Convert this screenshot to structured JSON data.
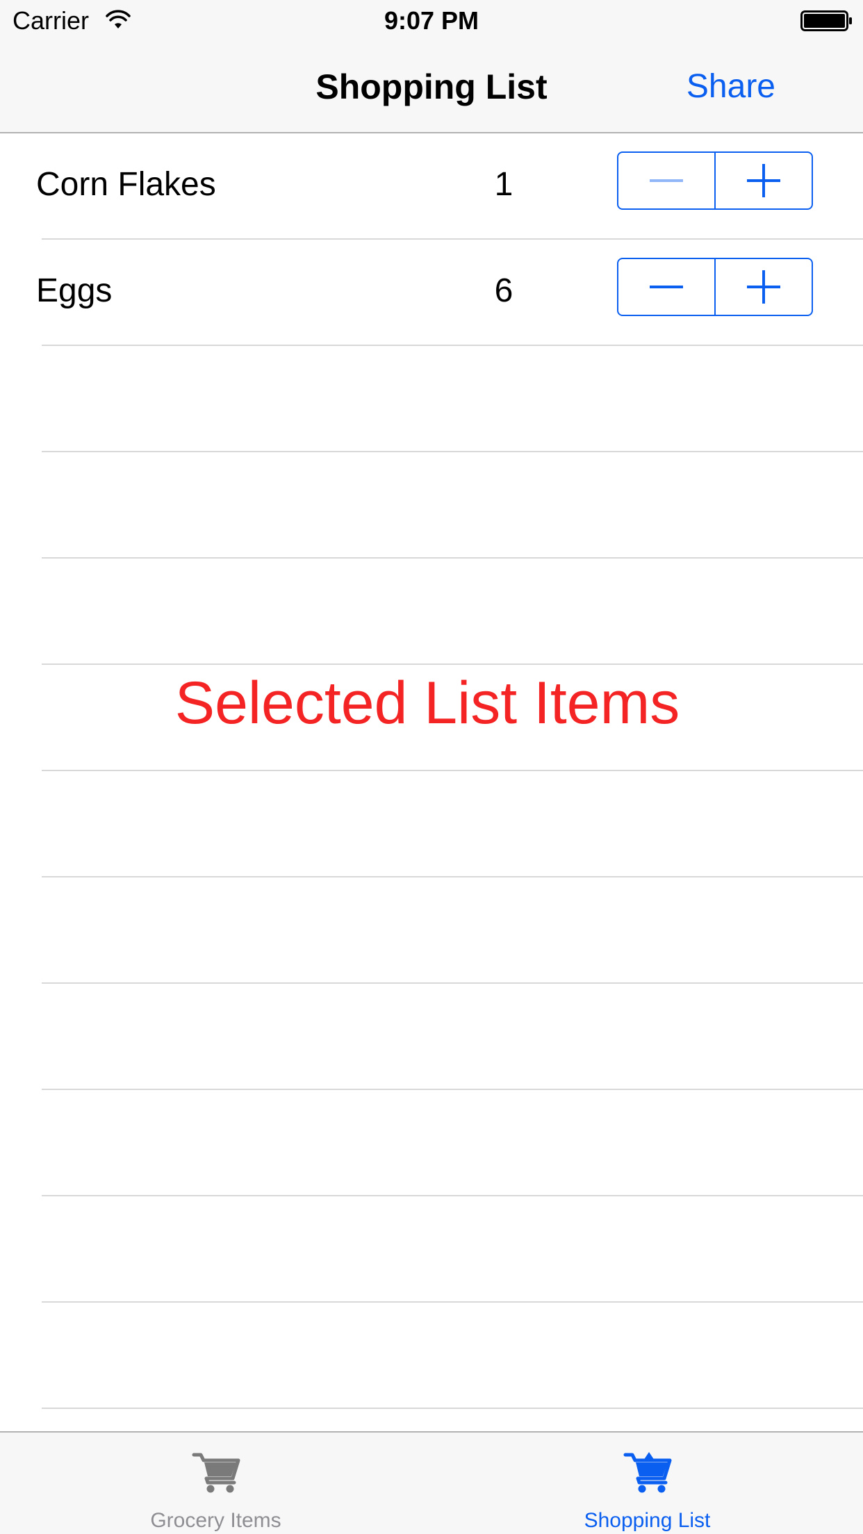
{
  "status_bar": {
    "carrier": "Carrier",
    "time": "9:07 PM",
    "wifi_icon": "wifi-icon",
    "battery_icon": "battery-full-icon"
  },
  "nav_bar": {
    "title": "Shopping List",
    "share_label": "Share"
  },
  "items": [
    {
      "name": "Corn Flakes",
      "quantity": "1",
      "minus_enabled": false
    },
    {
      "name": "Eggs",
      "quantity": "6",
      "minus_enabled": true
    }
  ],
  "overlay_caption": "Selected List Items",
  "tab_bar": {
    "tabs": [
      {
        "label": "Grocery Items",
        "icon": "cart-icon",
        "selected": false
      },
      {
        "label": "Shopping List",
        "icon": "cart-filled-icon",
        "selected": true
      }
    ]
  },
  "colors": {
    "accent": "#0a5ff0",
    "caption": "#f42424",
    "inactive_tab": "#8e8e93",
    "bar_background": "#f7f7f7"
  }
}
